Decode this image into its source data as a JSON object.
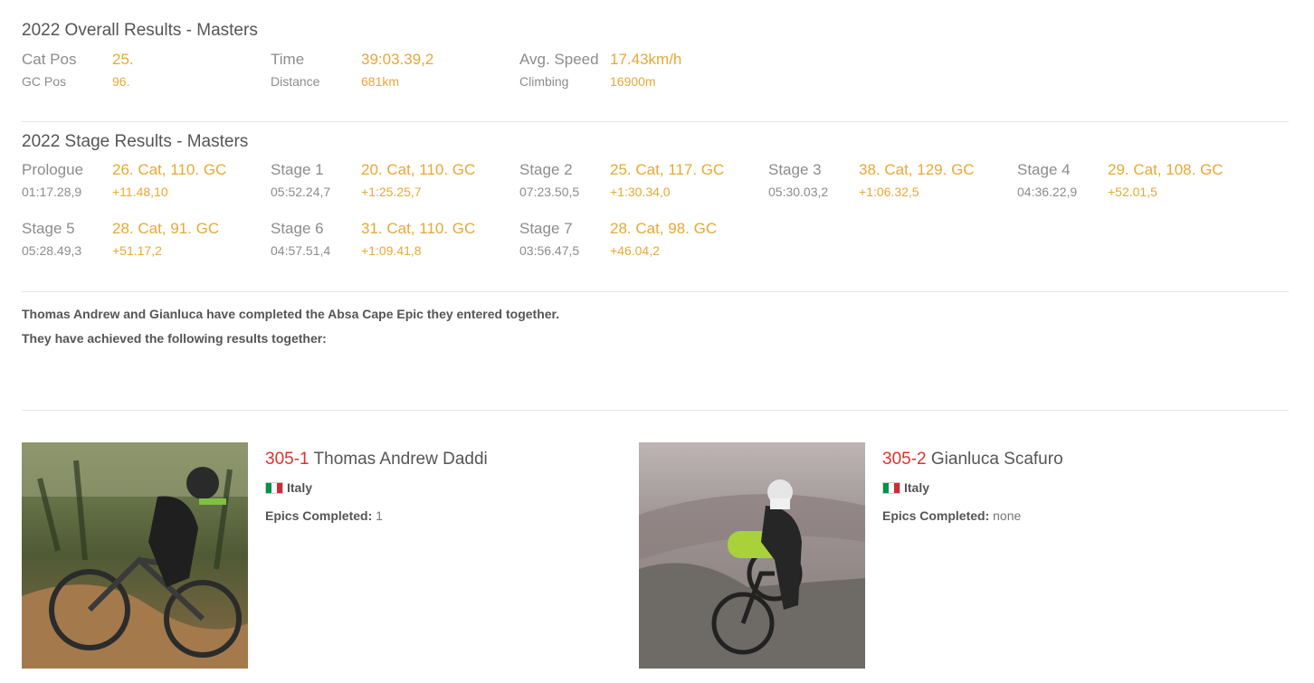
{
  "overall": {
    "title": "2022 Overall Results - Masters",
    "cat_pos_label": "Cat Pos",
    "cat_pos": "25.",
    "gc_pos_label": "GC Pos",
    "gc_pos": "96.",
    "time_label": "Time",
    "time": "39:03.39,2",
    "distance_label": "Distance",
    "distance": "681km",
    "speed_label": "Avg. Speed",
    "speed": "17.43km/h",
    "climbing_label": "Climbing",
    "climbing": "16900m"
  },
  "stages": {
    "title": "2022 Stage Results - Masters",
    "items": [
      {
        "name": "Prologue",
        "time": "01:17.28,9",
        "result": "26. Cat, 110. GC",
        "gap": "+11.48,10"
      },
      {
        "name": "Stage 1",
        "time": "05:52.24,7",
        "result": "20. Cat, 110. GC",
        "gap": "+1:25.25,7"
      },
      {
        "name": "Stage 2",
        "time": "07:23.50,5",
        "result": "25. Cat, 117. GC",
        "gap": "+1:30.34,0"
      },
      {
        "name": "Stage 3",
        "time": "05:30.03,2",
        "result": "38. Cat, 129. GC",
        "gap": "+1:06.32,5"
      },
      {
        "name": "Stage 4",
        "time": "04:36.22,9",
        "result": "29. Cat, 108. GC",
        "gap": "+52.01,5"
      },
      {
        "name": "Stage 5",
        "time": "05:28.49,3",
        "result": "28. Cat, 91. GC",
        "gap": "+51.17,2"
      },
      {
        "name": "Stage 6",
        "time": "04:57.51,4",
        "result": "31. Cat, 110. GC",
        "gap": "+1:09.41,8"
      },
      {
        "name": "Stage 7",
        "time": "03:56.47,5",
        "result": "28. Cat, 98. GC",
        "gap": "+46.04,2"
      }
    ]
  },
  "team_note": {
    "line1": "Thomas Andrew and Gianluca have completed the Absa Cape Epic they entered together.",
    "line2": "They have achieved the following results together:"
  },
  "riders": [
    {
      "bib": "305-1",
      "name": "Thomas Andrew Daddi",
      "country": "Italy",
      "epics_label": "Epics Completed:",
      "epics": "1"
    },
    {
      "bib": "305-2",
      "name": "Gianluca Scafuro",
      "country": "Italy",
      "epics_label": "Epics Completed:",
      "epics": "none"
    }
  ],
  "colors": {
    "accent": "#e8a835",
    "bib": "#e0312d",
    "flag_green": "#009246",
    "flag_white": "#ffffff",
    "flag_red": "#ce2b37"
  }
}
